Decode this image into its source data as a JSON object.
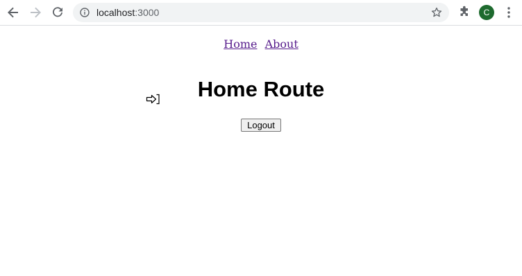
{
  "browser": {
    "url_host": "localhost",
    "url_port": ":3000",
    "profile_initial": "C",
    "icons": {
      "back": "back-arrow-icon",
      "forward": "forward-arrow-icon",
      "reload": "reload-icon",
      "site_info": "info-icon",
      "bookmark": "star-icon",
      "extensions": "puzzle-icon",
      "menu": "kebab-menu-icon"
    },
    "colors": {
      "avatar": "#1e6a2e",
      "omnibox": "#f1f3f4",
      "link": "#551a8b"
    }
  },
  "page": {
    "nav": {
      "home_label": "Home",
      "about_label": "About"
    },
    "title": "Home Route",
    "logout_label": "Logout",
    "cursor_icon": "logout-arrow-cursor-icon"
  }
}
